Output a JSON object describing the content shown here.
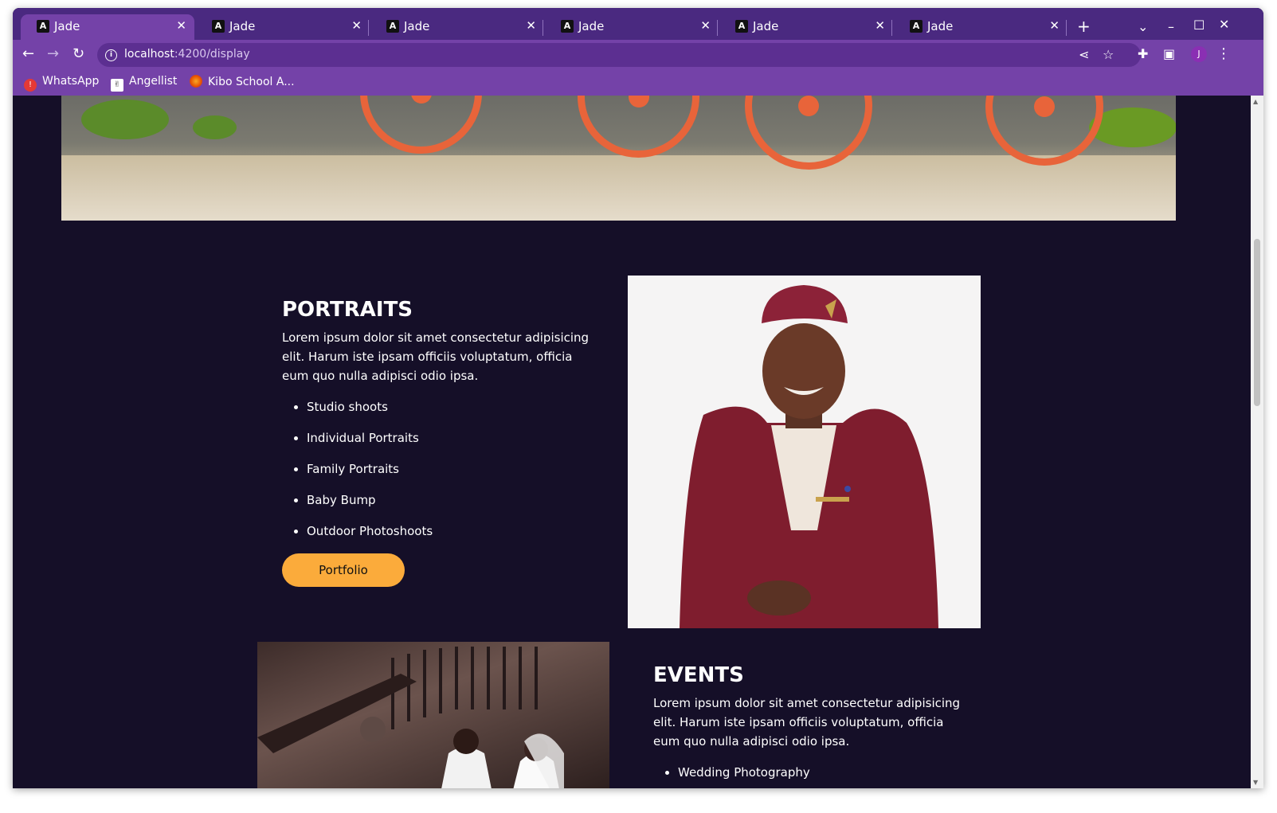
{
  "browser": {
    "tabs": [
      {
        "title": "Jade",
        "favicon": "A"
      },
      {
        "title": "Jade",
        "favicon": "A"
      },
      {
        "title": "Jade",
        "favicon": "A"
      },
      {
        "title": "Jade",
        "favicon": "A"
      },
      {
        "title": "Jade",
        "favicon": "A"
      },
      {
        "title": "Jade",
        "favicon": "A"
      }
    ],
    "url_host": "localhost",
    "url_path": ":4200/display",
    "avatar_letter": "J",
    "bookmarks": [
      {
        "label": "WhatsApp",
        "icon": "whatsapp-icon",
        "color": "#e53935"
      },
      {
        "label": "Angellist",
        "icon": "angellist-icon",
        "color": "#ffffff"
      },
      {
        "label": "Kibo School A...",
        "icon": "kibo-icon",
        "color": "#e65100"
      }
    ],
    "accent": "#7442a8",
    "tab_strip_color": "#4a2980"
  },
  "portraits": {
    "title": "PORTRAITS",
    "description": "Lorem ipsum dolor sit amet consectetur adipisicing elit. Harum iste ipsam officiis voluptatum, officia eum quo nulla adipisci odio ipsa.",
    "items": [
      "Studio shoots",
      "Individual Portraits",
      "Family Portraits",
      "Baby Bump",
      "Outdoor Photoshoots"
    ],
    "button_label": "Portfolio"
  },
  "events": {
    "title": "EVENTS",
    "description": "Lorem ipsum dolor sit amet consectetur adipisicing elit. Harum iste ipsam officiis voluptatum, officia eum quo nulla adipisci odio ipsa.",
    "items": [
      "Wedding Photography"
    ]
  },
  "colors": {
    "page_background": "#150f28",
    "button": "#fbab3b"
  }
}
